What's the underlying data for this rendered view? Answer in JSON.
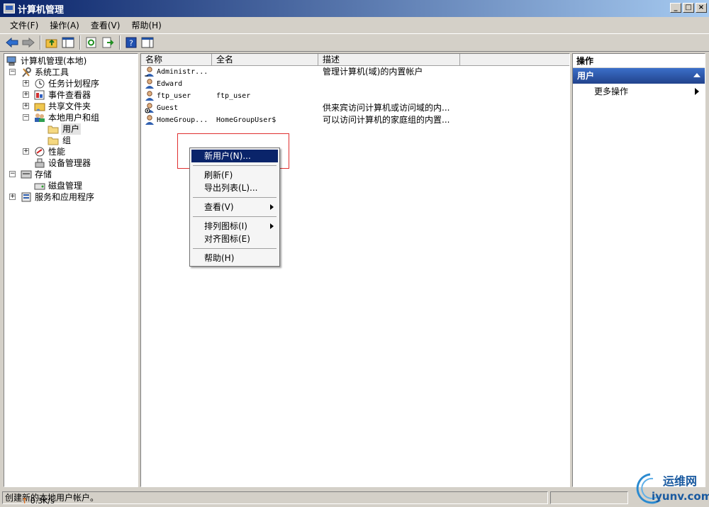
{
  "window": {
    "title": "计算机管理"
  },
  "menu": [
    "文件(F)",
    "操作(A)",
    "查看(V)",
    "帮助(H)"
  ],
  "tree": {
    "root": "计算机管理(本地)",
    "system_tools": "系统工具",
    "task_scheduler": "任务计划程序",
    "event_viewer": "事件查看器",
    "shared_folders": "共享文件夹",
    "local_users_groups": "本地用户和组",
    "users": "用户",
    "groups": "组",
    "performance": "性能",
    "device_manager": "设备管理器",
    "storage": "存储",
    "disk_management": "磁盘管理",
    "services_apps": "服务和应用程序"
  },
  "list": {
    "columns": [
      "名称",
      "全名",
      "描述"
    ],
    "rows": [
      {
        "name": "Administr...",
        "full": "",
        "desc": "管理计算机(域)的内置帐户"
      },
      {
        "name": "Edward",
        "full": "",
        "desc": ""
      },
      {
        "name": "ftp_user",
        "full": "ftp_user",
        "desc": ""
      },
      {
        "name": "Guest",
        "full": "",
        "desc": "供来宾访问计算机或访问域的内..."
      },
      {
        "name": "HomeGroup...",
        "full": "HomeGroupUser$",
        "desc": "可以访问计算机的家庭组的内置..."
      }
    ]
  },
  "actions": {
    "header": "操作",
    "section": "用户",
    "more": "更多操作"
  },
  "context_menu": {
    "new_user": "新用户(N)...",
    "refresh": "刷新(F)",
    "export_list": "导出列表(L)...",
    "view": "查看(V)",
    "arrange_icons": "排列图标(I)",
    "align_icons": "对齐图标(E)",
    "help": "帮助(H)"
  },
  "status": {
    "text": "创建新的本地用户帐户。",
    "speed": "0.3K/s",
    "speed_arrow": "↑"
  },
  "watermark": {
    "top": "运维网",
    "bottom": "iyunv.com"
  }
}
